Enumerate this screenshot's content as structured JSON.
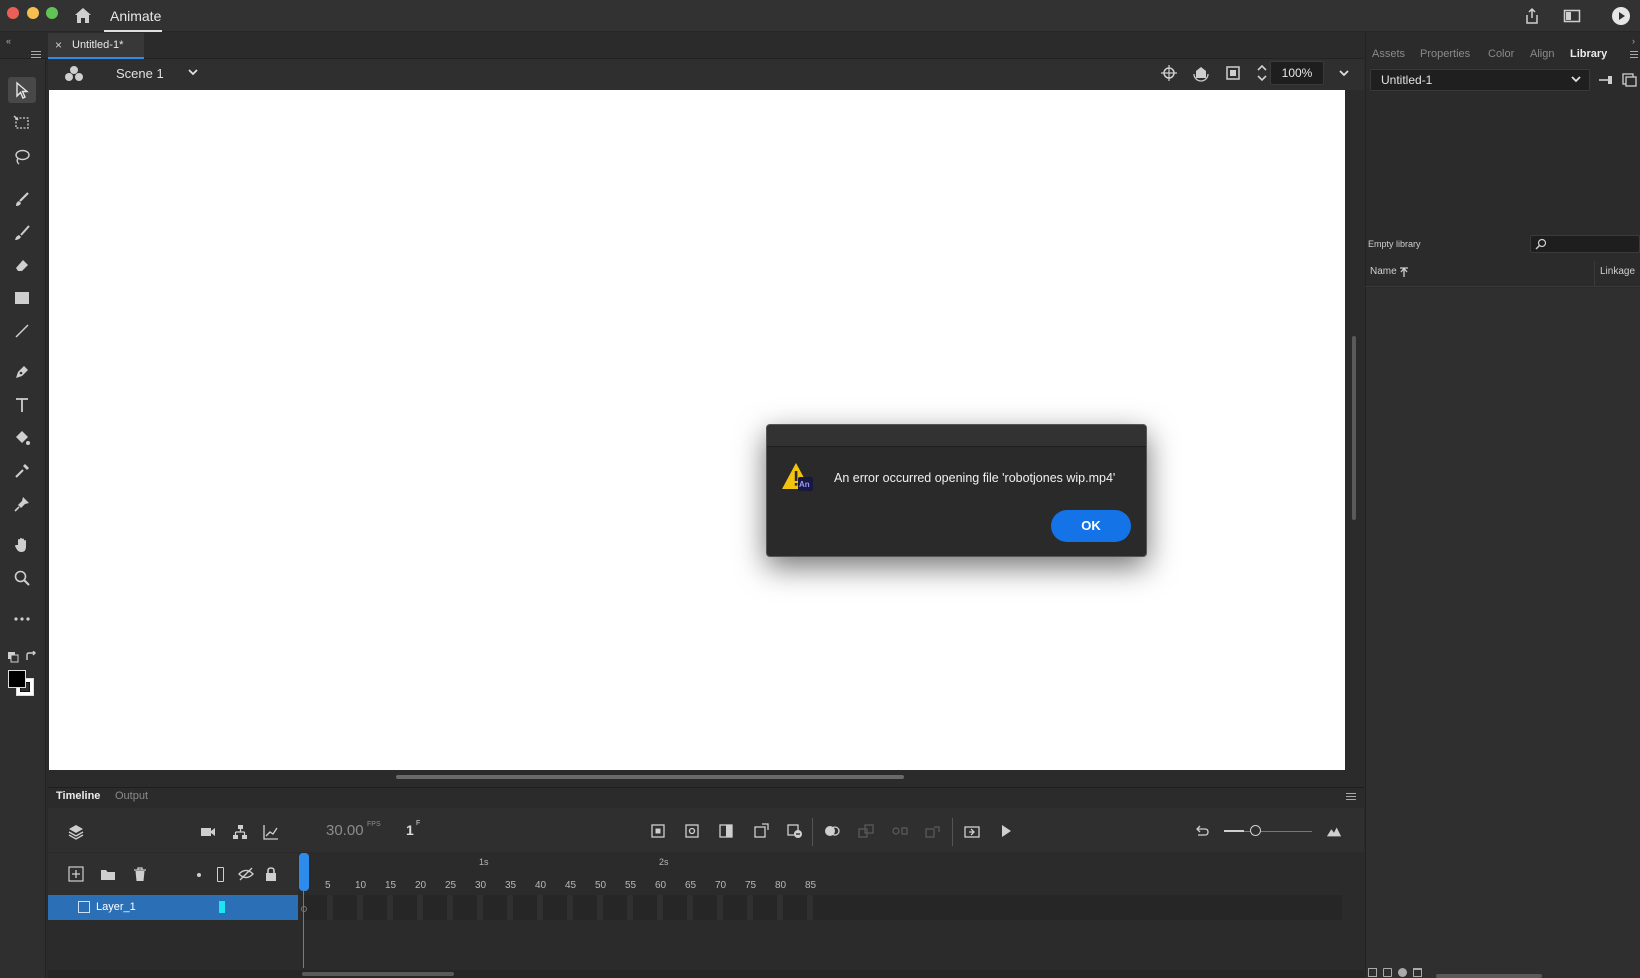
{
  "app": {
    "name": "Animate"
  },
  "document": {
    "tab_label": "Untitled-1*",
    "close_glyph": "×"
  },
  "scene": {
    "label": "Scene 1",
    "zoom": "100%"
  },
  "dialog": {
    "message": "An error occurred opening file 'robotjones wip.mp4'",
    "ok_label": "OK",
    "badge": "An"
  },
  "right_panel": {
    "tabs": [
      "Assets",
      "Properties",
      "Color",
      "Align",
      "Library"
    ],
    "active_tab": "Library",
    "library_select": "Untitled-1",
    "empty_text": "Empty library",
    "columns": {
      "name": "Name",
      "linkage": "Linkage"
    }
  },
  "timeline": {
    "tabs": [
      "Timeline",
      "Output"
    ],
    "fps": "30.00",
    "fps_unit": "FPS",
    "frame": "1",
    "frame_unit": "F",
    "layer_name": "Layer_1",
    "frame_numbers": [
      "5",
      "10",
      "15",
      "20",
      "25",
      "30",
      "35",
      "40",
      "45",
      "50",
      "55",
      "60",
      "65",
      "70",
      "75",
      "80",
      "85"
    ],
    "seconds": [
      "1s",
      "2s"
    ]
  },
  "colors": {
    "accent": "#1473e6",
    "layer_selected": "#2b6fb6",
    "layer_color": "#19e6f0"
  }
}
